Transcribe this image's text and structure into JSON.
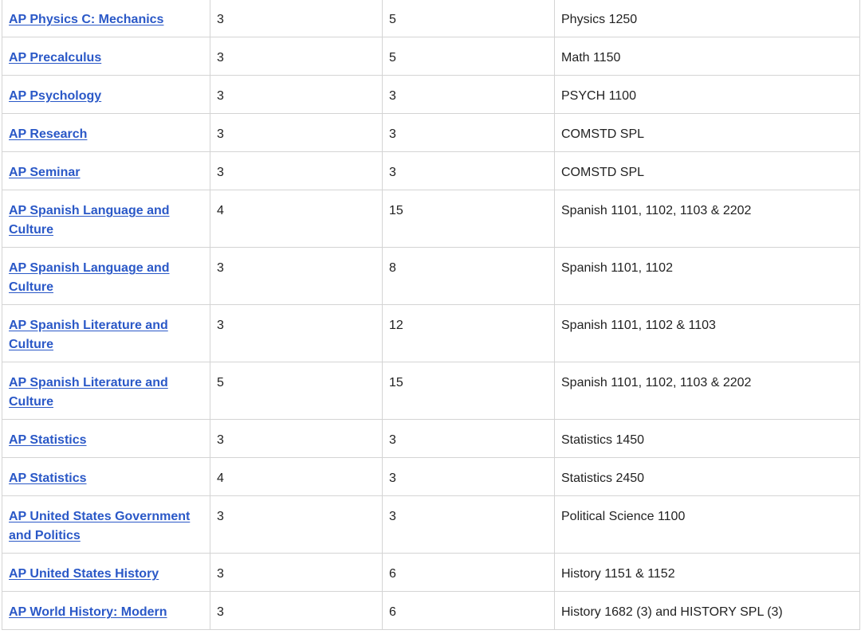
{
  "rows": [
    {
      "exam": "AP Physics C: Mechanics",
      "score": "3",
      "credits": "5",
      "equivalent": "Physics 1250"
    },
    {
      "exam": "AP Precalculus",
      "score": "3",
      "credits": "5",
      "equivalent": "Math 1150"
    },
    {
      "exam": "AP Psychology",
      "score": "3",
      "credits": "3",
      "equivalent": "PSYCH 1100"
    },
    {
      "exam": "AP Research",
      "score": "3",
      "credits": "3",
      "equivalent": "COMSTD SPL"
    },
    {
      "exam": "AP Seminar",
      "score": "3",
      "credits": "3",
      "equivalent": "COMSTD SPL"
    },
    {
      "exam": "AP Spanish Language and Culture",
      "score": "4",
      "credits": "15",
      "equivalent": "Spanish 1101, 1102, 1103 & 2202"
    },
    {
      "exam": "AP Spanish Language and Culture",
      "score": "3",
      "credits": "8",
      "equivalent": "Spanish 1101, 1102"
    },
    {
      "exam": "AP Spanish Literature and Culture",
      "score": "3",
      "credits": "12",
      "equivalent": "Spanish 1101, 1102 & 1103"
    },
    {
      "exam": "AP Spanish Literature and Culture",
      "score": "5",
      "credits": "15",
      "equivalent": "Spanish 1101, 1102, 1103 & 2202"
    },
    {
      "exam": "AP Statistics",
      "score": "3",
      "credits": "3",
      "equivalent": "Statistics 1450"
    },
    {
      "exam": "AP Statistics",
      "score": "4",
      "credits": "3",
      "equivalent": "Statistics 2450"
    },
    {
      "exam": "AP United States Government and Politics",
      "score": "3",
      "credits": "3",
      "equivalent": "Political Science 1100"
    },
    {
      "exam": "AP United States History",
      "score": "3",
      "credits": "6",
      "equivalent": "History 1151 & 1152"
    },
    {
      "exam": "AP World History: Modern",
      "score": "3",
      "credits": "6",
      "equivalent": "History 1682 (3) and HISTORY SPL (3)"
    }
  ]
}
